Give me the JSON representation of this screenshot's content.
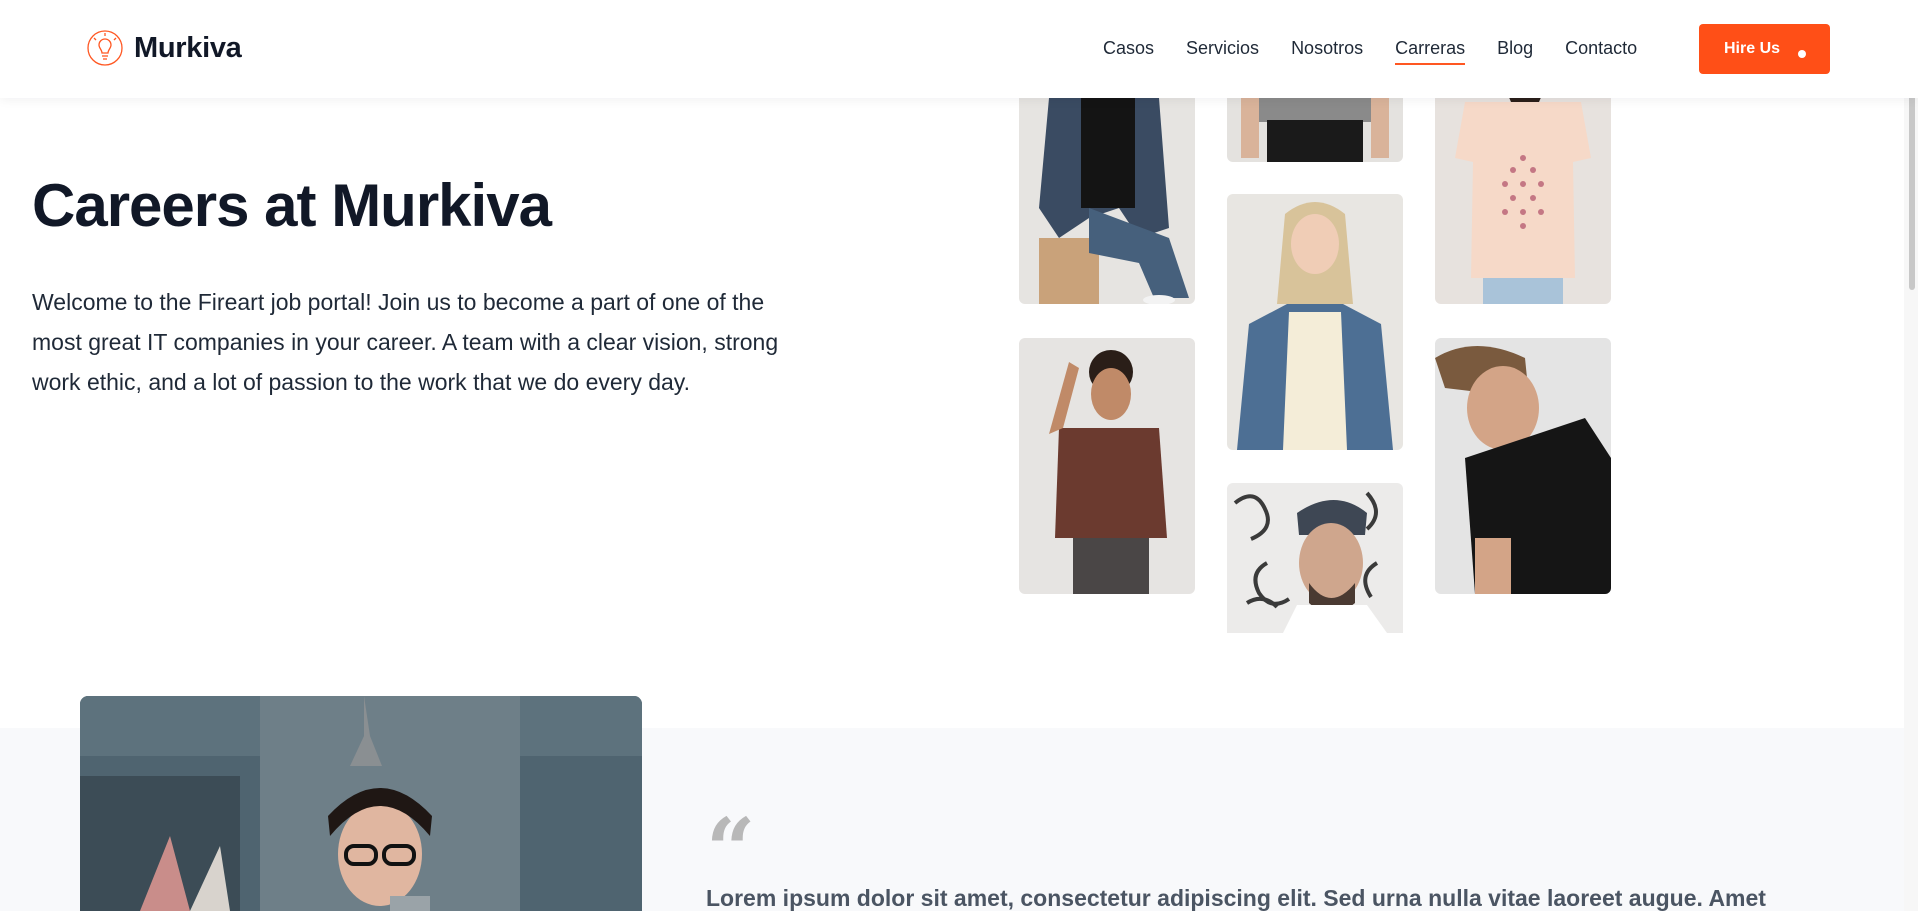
{
  "header": {
    "brand": "Murkiva",
    "nav": [
      {
        "label": "Casos",
        "active": false
      },
      {
        "label": "Servicios",
        "active": false
      },
      {
        "label": "Nosotros",
        "active": false
      },
      {
        "label": "Carreras",
        "active": true
      },
      {
        "label": "Blog",
        "active": false
      },
      {
        "label": "Contacto",
        "active": false
      }
    ],
    "cta_label": "Hire Us"
  },
  "hero": {
    "title": "Careers at Murkiva",
    "description": "Welcome to the Fireart job portal! Join us to become a part of one of the most great IT companies in your career. A team with a clear vision, strong work ethic, and a lot of passion to the work that we do every day."
  },
  "gallery": {
    "photos": [
      {
        "subject": "woman-denim-jacket"
      },
      {
        "subject": "person-gray-tshirt"
      },
      {
        "subject": "woman-pink-tshirt"
      },
      {
        "subject": "blonde-woman-denim-jacket"
      },
      {
        "subject": "man-brown-tshirt"
      },
      {
        "subject": "man-black-tshirt"
      },
      {
        "subject": "man-beanie-glasses"
      }
    ]
  },
  "testimonial": {
    "quote_mark": "“",
    "text": "Lorem ipsum dolor sit amet, consectetur adipiscing elit. Sed urna nulla vitae laoreet augue. Amet"
  },
  "colors": {
    "accent": "#ff4f17",
    "heading": "#111827",
    "section_bg": "#f8f9fb"
  }
}
